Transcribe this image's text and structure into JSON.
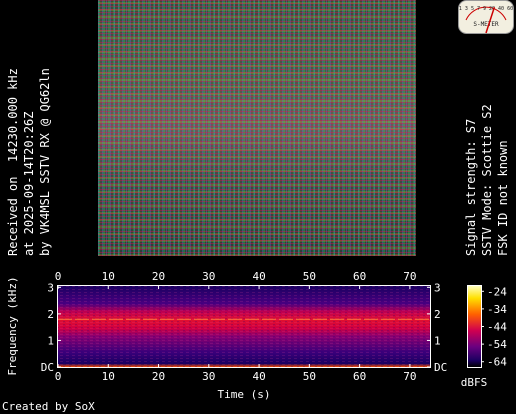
{
  "left_caption": {
    "line1": "Received on  14230.000 kHz",
    "line2": "at 2025-09-14T20:26Z",
    "line3": "by VK4MSL SSTV RX @ QG62ln"
  },
  "right_caption": {
    "line1": "Signal strength: S7",
    "line2": "SSTV Mode: Scottie S2",
    "line3": "FSK ID not known"
  },
  "smeter": {
    "scale": "1 3 5 7 9 20 40 60",
    "label": "S-METER",
    "needle_fraction": 0.6
  },
  "spectrogram": {
    "x_ticks": [
      "0",
      "10",
      "20",
      "30",
      "40",
      "50",
      "60",
      "70"
    ],
    "x_values": [
      0,
      10,
      20,
      30,
      40,
      50,
      60,
      70
    ],
    "x_max": 74,
    "y_ticks_left": [
      "3",
      "2",
      "1",
      "DC"
    ],
    "y_ticks_right": [
      "3",
      "2",
      "1",
      "DC"
    ],
    "y_values": [
      3,
      2,
      1,
      0
    ],
    "y_max": 3.05,
    "xlabel": "Time (s)",
    "ylabel": "Frequency (kHz)",
    "colorbar_ticks": [
      "-24",
      "-34",
      "-44",
      "-54",
      "-64"
    ],
    "colorbar_values": [
      -24,
      -34,
      -44,
      -54,
      -64
    ],
    "colorbar_range": [
      -67,
      -21
    ],
    "colorbar_label": "dBFS",
    "signal_band_khz": 1.8,
    "colors": {
      "high": "#ffff80",
      "mid": "#ff4000",
      "low": "#a0006a",
      "floor": "#1a0060",
      "deep": "#000000"
    }
  },
  "footer": "Created by SoX"
}
